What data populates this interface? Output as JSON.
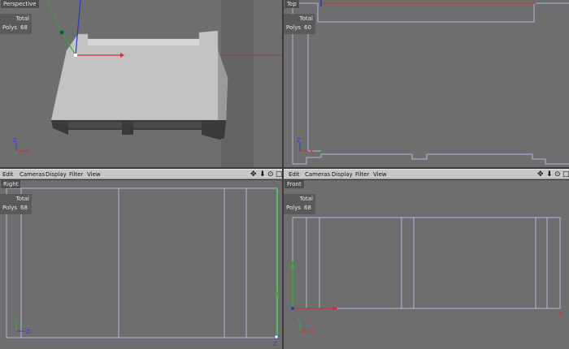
{
  "viewports": {
    "perspective": {
      "label": "Perspective",
      "stats_header": "Total",
      "stats_label": "Polys",
      "stats_value": "68"
    },
    "top": {
      "label": "Top",
      "stats_header": "Total",
      "stats_label": "Polys",
      "stats_value": "60"
    },
    "right": {
      "label": "Right",
      "stats_header": "Total",
      "stats_label": "Polys",
      "stats_value": "68"
    },
    "front": {
      "label": "Front",
      "stats_header": "Total",
      "stats_label": "Polys",
      "stats_value": "68"
    }
  },
  "menus": {
    "left": {
      "edit": "Edit",
      "cameras": "Cameras",
      "display": "Display",
      "filter": "Filter",
      "view": "View"
    },
    "right": {
      "edit": "Edit",
      "cameras": "Cameras",
      "display": "Display",
      "filter": "Filter",
      "view": "View"
    }
  },
  "axes": {
    "x": "X",
    "y": "Y",
    "z": "Z"
  },
  "colors": {
    "viewport_bg": "#6e6e6e",
    "wireframe": "#aebadc",
    "x_axis": "#d23030",
    "y_axis": "#30b030",
    "z_axis": "#3040c0",
    "menubar": "#c7c7c7"
  },
  "icons": {
    "move": "move-icon",
    "rotate": "down-arrow-icon",
    "zoom": "zoom-icon",
    "maximize": "maximize-icon"
  }
}
